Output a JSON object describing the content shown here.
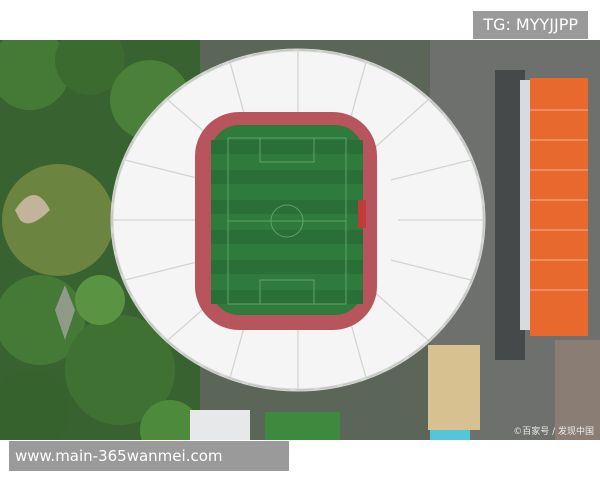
{
  "watermark_top": "TG: MYYJJPP",
  "watermark_bottom": "www.main-365wanmei.com",
  "photo_credit": "©百家号 / 发现中国",
  "colors": {
    "background": "#ffffff",
    "banner": "#9a9a9a",
    "pitch": "#2f7a3d",
    "roof": "#f4f5f4",
    "track": "#b8545b",
    "orange_roof": "#e8692e",
    "trees": "#3f6e34"
  }
}
